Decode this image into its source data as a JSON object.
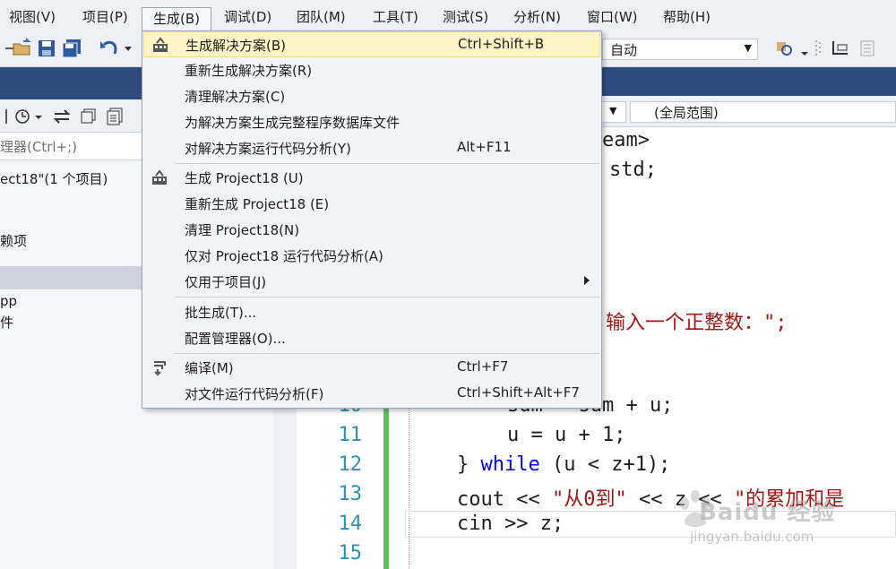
{
  "menubar": {
    "items": [
      "视图(V)",
      "项目(P)",
      "生成(B)",
      "调试(D)",
      "团队(M)",
      "工具(T)",
      "测试(S)",
      "分析(N)",
      "窗口(W)",
      "帮助(H)"
    ]
  },
  "toolbar": {
    "config_value": "自动"
  },
  "solution_explorer": {
    "search_placeholder": "理器(Ctrl+;)",
    "solution_label": "ect18\"(1 个项目)",
    "item_a": "赖项",
    "item_b": "pp",
    "item_c": "件"
  },
  "editor": {
    "scope_combo": "(全局范围)",
    "lines": [
      {
        "no": "",
        "text": "eam>"
      },
      {
        "no": "",
        "text": "std;"
      },
      {
        "no": "",
        "text": "输入一个正整数：\";"
      },
      {
        "no": "10",
        "text": "sum = sum + u;"
      },
      {
        "no": "11",
        "text": "u = u + 1;"
      },
      {
        "no": "12",
        "pre": "} ",
        "kw": "while",
        "post": " (u < z+1);"
      },
      {
        "no": "13",
        "pre": "cout << ",
        "s1": "\"从0到\"",
        "mid": " << z << ",
        "s2": "\"的累加和是"
      },
      {
        "no": "14",
        "text": "cin >> z;"
      },
      {
        "no": "15",
        "text": ""
      }
    ]
  },
  "build_menu": {
    "items": [
      {
        "label": "生成解决方案(B)",
        "shortcut": "Ctrl+Shift+B",
        "icon": "build-solution-icon"
      },
      {
        "label": "重新生成解决方案(R)",
        "shortcut": ""
      },
      {
        "label": "清理解决方案(C)",
        "shortcut": ""
      },
      {
        "label": "为解决方案生成完整程序数据库文件",
        "shortcut": ""
      },
      {
        "label": "对解决方案运行代码分析(Y)",
        "shortcut": "Alt+F11"
      },
      {
        "label": "生成 Project18 (U)",
        "shortcut": "",
        "icon": "build-project-icon"
      },
      {
        "label": "重新生成 Project18 (E)",
        "shortcut": ""
      },
      {
        "label": "清理 Project18(N)",
        "shortcut": ""
      },
      {
        "label": "仅对 Project18 运行代码分析(A)",
        "shortcut": ""
      },
      {
        "label": "仅用于项目(J)",
        "shortcut": "",
        "submenu": true
      },
      {
        "label": "批生成(T)...",
        "shortcut": ""
      },
      {
        "label": "配置管理器(O)...",
        "shortcut": ""
      },
      {
        "label": "编译(M)",
        "shortcut": "Ctrl+F7",
        "icon": "compile-icon"
      },
      {
        "label": "对文件运行代码分析(F)",
        "shortcut": "Ctrl+Shift+Alt+F7"
      }
    ]
  },
  "watermark": {
    "brand": "Baidu 经验",
    "url": "jingyan.baidu.com"
  },
  "colors": {
    "accent_blue": "#2e4b7d",
    "highlight": "#fef5c6",
    "green_change_bar": "#5dc25d",
    "keyword": "#0000ff",
    "string": "#a31515",
    "line_number": "#2b91af"
  }
}
